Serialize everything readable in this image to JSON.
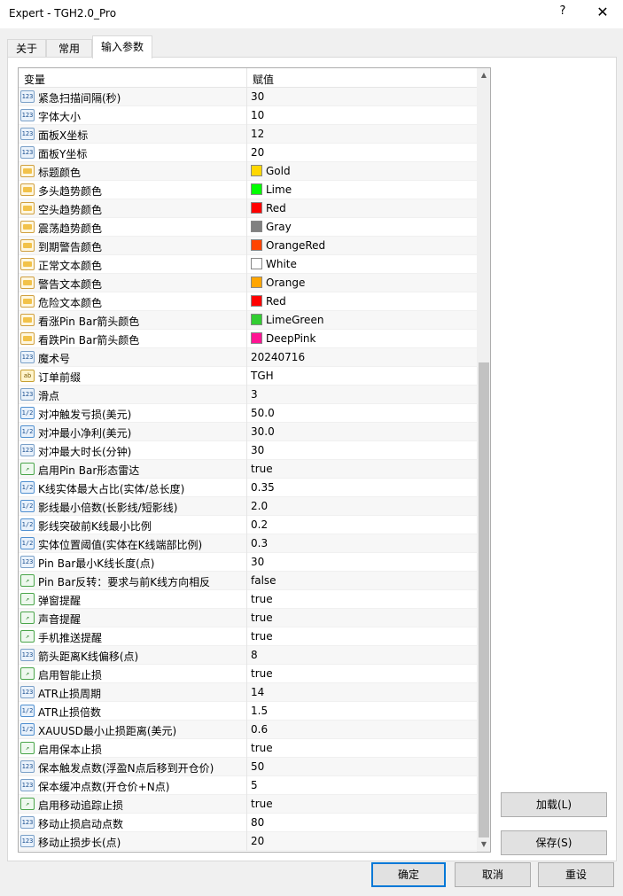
{
  "window": {
    "title": "Expert - TGH2.0_Pro",
    "help": "?",
    "close": "✕"
  },
  "tabs": [
    {
      "label": "关于",
      "active": false
    },
    {
      "label": "常用",
      "active": false
    },
    {
      "label": "输入参数",
      "active": true
    }
  ],
  "grid": {
    "col_variable": "变量",
    "col_value": "赋值",
    "rows": [
      {
        "icon": "int",
        "name": "紧急扫描间隔(秒)",
        "value": "30"
      },
      {
        "icon": "int",
        "name": "字体大小",
        "value": "10"
      },
      {
        "icon": "int",
        "name": "面板X坐标",
        "value": "12"
      },
      {
        "icon": "int",
        "name": "面板Y坐标",
        "value": "20"
      },
      {
        "icon": "color",
        "name": "标题颜色",
        "value": "Gold",
        "swatch": "#FFD700"
      },
      {
        "icon": "color",
        "name": "多头趋势颜色",
        "value": "Lime",
        "swatch": "#00FF00"
      },
      {
        "icon": "color",
        "name": "空头趋势颜色",
        "value": "Red",
        "swatch": "#FF0000"
      },
      {
        "icon": "color",
        "name": "震荡趋势颜色",
        "value": "Gray",
        "swatch": "#808080"
      },
      {
        "icon": "color",
        "name": "到期警告颜色",
        "value": "OrangeRed",
        "swatch": "#FF4500"
      },
      {
        "icon": "color",
        "name": "正常文本颜色",
        "value": "White",
        "swatch": "#FFFFFF"
      },
      {
        "icon": "color",
        "name": "警告文本颜色",
        "value": "Orange",
        "swatch": "#FFA500"
      },
      {
        "icon": "color",
        "name": "危险文本颜色",
        "value": "Red",
        "swatch": "#FF0000"
      },
      {
        "icon": "color",
        "name": "看涨Pin Bar箭头颜色",
        "value": "LimeGreen",
        "swatch": "#32CD32"
      },
      {
        "icon": "color",
        "name": "看跌Pin Bar箭头颜色",
        "value": "DeepPink",
        "swatch": "#FF1493"
      },
      {
        "icon": "int",
        "name": "魔术号",
        "value": "20240716"
      },
      {
        "icon": "text",
        "name": "订单前缀",
        "value": "TGH"
      },
      {
        "icon": "int",
        "name": "滑点",
        "value": "3"
      },
      {
        "icon": "double",
        "name": "对冲触发亏损(美元)",
        "value": "50.0"
      },
      {
        "icon": "double",
        "name": "对冲最小净利(美元)",
        "value": "30.0"
      },
      {
        "icon": "int",
        "name": "对冲最大时长(分钟)",
        "value": "30"
      },
      {
        "icon": "bool",
        "name": "启用Pin Bar形态雷达",
        "value": "true"
      },
      {
        "icon": "double",
        "name": "K线实体最大占比(实体/总长度)",
        "value": "0.35"
      },
      {
        "icon": "double",
        "name": "影线最小倍数(长影线/短影线)",
        "value": "2.0"
      },
      {
        "icon": "double",
        "name": "影线突破前K线最小比例",
        "value": "0.2"
      },
      {
        "icon": "double",
        "name": "实体位置阈值(实体在K线端部比例)",
        "value": "0.3"
      },
      {
        "icon": "int",
        "name": "Pin Bar最小K线长度(点)",
        "value": "30"
      },
      {
        "icon": "bool",
        "name": "Pin Bar反转：要求与前K线方向相反",
        "value": "false"
      },
      {
        "icon": "bool",
        "name": "弹窗提醒",
        "value": "true"
      },
      {
        "icon": "bool",
        "name": "声音提醒",
        "value": "true"
      },
      {
        "icon": "bool",
        "name": "手机推送提醒",
        "value": "true"
      },
      {
        "icon": "int",
        "name": "箭头距离K线偏移(点)",
        "value": "8"
      },
      {
        "icon": "bool",
        "name": "启用智能止损",
        "value": "true"
      },
      {
        "icon": "int",
        "name": "ATR止损周期",
        "value": "14"
      },
      {
        "icon": "double",
        "name": "ATR止损倍数",
        "value": "1.5"
      },
      {
        "icon": "double",
        "name": "XAUUSD最小止损距离(美元)",
        "value": "0.6"
      },
      {
        "icon": "bool",
        "name": "启用保本止损",
        "value": "true"
      },
      {
        "icon": "int",
        "name": "保本触发点数(浮盈N点后移到开仓价)",
        "value": "50"
      },
      {
        "icon": "int",
        "name": "保本缓冲点数(开仓价+N点)",
        "value": "5"
      },
      {
        "icon": "bool",
        "name": "启用移动追踪止损",
        "value": "true"
      },
      {
        "icon": "int",
        "name": "移动止损启动点数",
        "value": "80"
      },
      {
        "icon": "int",
        "name": "移动止损步长(点)",
        "value": "20"
      }
    ]
  },
  "buttons": {
    "load": "加载(L)",
    "save": "保存(S)",
    "ok": "确定",
    "cancel": "取消",
    "reset": "重设"
  }
}
